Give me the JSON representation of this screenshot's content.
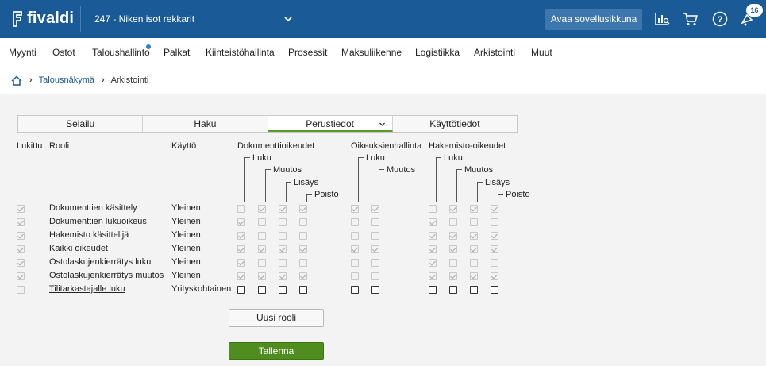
{
  "app": {
    "brand": "fivaldi",
    "company": "247 - Niken isot rekkarit",
    "open_apps_label": "Avaa sovellusikkuna",
    "notification_count": "16"
  },
  "nav": [
    "Myynti",
    "Ostot",
    "Taloushallinto",
    "Palkat",
    "Kiinteistöhallinta",
    "Prosessit",
    "Maksuliikenne",
    "Logistiikka",
    "Arkistointi",
    "Muut"
  ],
  "breadcrumb": {
    "parent": "Talousnäkymä",
    "current": "Arkistointi"
  },
  "tabs": [
    "Selailu",
    "Haku",
    "Perustiedot",
    "Käyttötiedot"
  ],
  "headers": {
    "locked": "Lukittu",
    "role": "Rooli",
    "usage": "Käyttö",
    "doc_rights": "Dokumenttioikeudet",
    "rights_mgmt": "Oikeuksienhallinta",
    "dir_rights": "Hakemisto-oikeudet",
    "read": "Luku",
    "modify": "Muutos",
    "add": "Lisäys",
    "delete": "Poisto"
  },
  "rows": [
    {
      "role": "Dokumenttien käsittely",
      "usage": "Yleinen",
      "link": false,
      "locked": true,
      "doc": [
        false,
        true,
        true,
        true
      ],
      "mgmt": [
        true,
        true
      ],
      "dir": [
        false,
        true,
        true,
        true
      ],
      "live": false
    },
    {
      "role": "Dokumenttien lukuoikeus",
      "usage": "Yleinen",
      "link": false,
      "locked": true,
      "doc": [
        true,
        false,
        false,
        false
      ],
      "mgmt": [
        false,
        false
      ],
      "dir": [
        true,
        false,
        false,
        false
      ],
      "live": false
    },
    {
      "role": "Hakemisto käsittelijä",
      "usage": "Yleinen",
      "link": false,
      "locked": true,
      "doc": [
        true,
        false,
        false,
        false
      ],
      "mgmt": [
        false,
        false
      ],
      "dir": [
        true,
        true,
        true,
        true
      ],
      "live": false
    },
    {
      "role": "Kaikki oikeudet",
      "usage": "Yleinen",
      "link": false,
      "locked": true,
      "doc": [
        true,
        true,
        true,
        true
      ],
      "mgmt": [
        true,
        true
      ],
      "dir": [
        true,
        true,
        true,
        true
      ],
      "live": false
    },
    {
      "role": "Ostolaskujenkierrätys luku",
      "usage": "Yleinen",
      "link": false,
      "locked": true,
      "doc": [
        true,
        false,
        false,
        false
      ],
      "mgmt": [
        false,
        false
      ],
      "dir": [
        true,
        false,
        false,
        false
      ],
      "live": false
    },
    {
      "role": "Ostolaskujenkierrätys muutos",
      "usage": "Yleinen",
      "link": false,
      "locked": true,
      "doc": [
        true,
        true,
        true,
        true
      ],
      "mgmt": [
        false,
        false
      ],
      "dir": [
        true,
        true,
        true,
        true
      ],
      "live": false
    },
    {
      "role": "Tilitarkastajalle luku",
      "usage": "Yrityskohtainen",
      "link": true,
      "locked": false,
      "doc": [
        false,
        false,
        false,
        false
      ],
      "mgmt": [
        false,
        false
      ],
      "dir": [
        false,
        false,
        false,
        false
      ],
      "live": true
    }
  ],
  "buttons": {
    "new_role": "Uusi rooli",
    "save": "Tallenna"
  },
  "colors": {
    "topbar": "#1a5a96",
    "save_button": "#4e8d1e",
    "active_tab_underline": "#5a9a2a"
  }
}
